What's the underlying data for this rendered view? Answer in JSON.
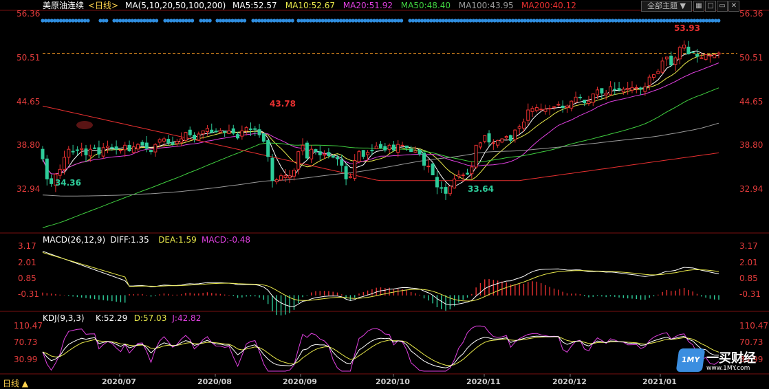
{
  "header": {
    "instrument": "美原油连续",
    "period": "<日线>",
    "ma_label": "MA(5,10,20,50,100,200)",
    "ma_values": [
      {
        "text": "MA5:52.57",
        "color": "#ffffff"
      },
      {
        "text": "MA10:52.67",
        "color": "#e8e84a"
      },
      {
        "text": "MA20:51.92",
        "color": "#e040e0"
      },
      {
        "text": "MA50:48.40",
        "color": "#40d040"
      },
      {
        "text": "MA100:43.95",
        "color": "#9a9a9a"
      },
      {
        "text": "MA200:40.12",
        "color": "#e83030"
      }
    ],
    "theme_button": "全部主题",
    "icons": [
      "grid-icon",
      "maximize-icon",
      "restore-icon",
      "close-icon"
    ]
  },
  "colors": {
    "up": "#e83030",
    "down": "#2ecc9a",
    "ma5": "#ffffff",
    "ma10": "#e8e84a",
    "ma20": "#e040e0",
    "ma50": "#40d040",
    "ma100": "#9a9a9a",
    "ma200": "#e83030",
    "axis_text": "#e53c3c",
    "dots": "#2f8ee0",
    "ref_line": "#e89020"
  },
  "price_axis": {
    "ticks": [
      "56.36",
      "50.51",
      "44.65",
      "38.80",
      "32.94"
    ]
  },
  "macd_axis": {
    "ticks": [
      "3.17",
      "2.01",
      "0.85",
      "-0.31"
    ]
  },
  "kdj_axis": {
    "ticks": [
      "110.47",
      "70.73",
      "30.99"
    ]
  },
  "date_axis": {
    "ticks": [
      "2020/07",
      "2020/08",
      "2020/09",
      "2020/10",
      "2020/11",
      "2020/12",
      "2021/01"
    ]
  },
  "macd_header": [
    {
      "text": "MACD(26,12,9)",
      "color": "#ffffff"
    },
    {
      "text": "DIFF:1.35",
      "color": "#ffffff"
    },
    {
      "text": "DEA:1.59",
      "color": "#e8e84a"
    },
    {
      "text": "MACD:-0.48",
      "color": "#e040e0"
    }
  ],
  "kdj_header": [
    {
      "text": "KDJ(9,3,3)",
      "color": "#ffffff"
    },
    {
      "text": "K:52.29",
      "color": "#ffffff"
    },
    {
      "text": "D:57.03",
      "color": "#e8e84a"
    },
    {
      "text": "J:42.82",
      "color": "#e040e0"
    }
  ],
  "annotations": [
    {
      "text": "43.78",
      "color": "#e83030"
    },
    {
      "text": "34.36",
      "color": "#2ecc9a"
    },
    {
      "text": "33.64",
      "color": "#2ecc9a"
    },
    {
      "text": "53.93",
      "color": "#e83030"
    }
  ],
  "period_button": "日线 ▲",
  "watermark": {
    "mark": "1MY",
    "name": "一买财经",
    "url": "www.1MY.com"
  },
  "chart_data": {
    "type": "candlestick",
    "title": "美原油连续 <日线>",
    "ylim": [
      30.5,
      57.5
    ],
    "reference_price": 52.57,
    "close": [
      39.4,
      36.9,
      36.3,
      37.5,
      38.1,
      39.6,
      40.6,
      40.3,
      40.5,
      40.7,
      39.9,
      40.6,
      40.7,
      40.0,
      40.8,
      41.0,
      40.8,
      40.6,
      40.5,
      41.1,
      40.4,
      40.9,
      41.2,
      41.1,
      40.7,
      40.3,
      41.2,
      41.8,
      41.9,
      41.4,
      41.2,
      41.6,
      41.9,
      42.7,
      42.4,
      41.9,
      42.5,
      42.9,
      43.2,
      42.7,
      42.8,
      42.9,
      42.8,
      42.9,
      42.6,
      42.0,
      42.9,
      43.3,
      43.1,
      43.1,
      42.4,
      41.6,
      39.7,
      36.7,
      36.8,
      37.3,
      37.3,
      37.3,
      38.0,
      40.3,
      41.1,
      39.5,
      40.6,
      40.3,
      39.9,
      40.0,
      39.8,
      39.6,
      39.4,
      38.6,
      36.9,
      37.2,
      39.2,
      40.3,
      39.7,
      40.2,
      40.4,
      41.0,
      40.8,
      40.5,
      41.1,
      40.5,
      41.2,
      41.1,
      40.8,
      40.3,
      40.4,
      40.0,
      38.6,
      38.5,
      37.4,
      35.9,
      35.8,
      35.1,
      36.0,
      36.9,
      37.4,
      37.4,
      37.5,
      38.4,
      41.1,
      41.4,
      42.3,
      41.5,
      41.4,
      41.7,
      41.9,
      42.2,
      41.7,
      43.0,
      43.4,
      44.0,
      45.5,
      45.7,
      45.8,
      45.6,
      45.6,
      45.7,
      45.9,
      46.2,
      45.8,
      46.0,
      46.6,
      47.1,
      47.0,
      46.4,
      46.6,
      47.5,
      48.0,
      47.6,
      47.6,
      48.4,
      48.1,
      48.0,
      48.1,
      48.2,
      48.3,
      48.3,
      48.1,
      48.4,
      49.6,
      49.9,
      50.3,
      51.6,
      52.1,
      51.1,
      52.0,
      53.3,
      53.6,
      52.5,
      52.7,
      52.2,
      52.0,
      52.4,
      52.3,
      52.4,
      52.6
    ],
    "ma_lines": {
      "MA5": 52.57,
      "MA10": 52.67,
      "MA20": 51.92,
      "MA50": 48.4,
      "MA100": 43.95,
      "MA200": 40.12
    },
    "annotated_extremes": {
      "high_1": 43.78,
      "low_1": 34.36,
      "low_2": 33.64,
      "high_2": 53.93
    },
    "macd": {
      "ylim": [
        -1.3,
        3.5
      ]
    },
    "kdj": {
      "ylim": [
        0,
        125
      ]
    }
  }
}
